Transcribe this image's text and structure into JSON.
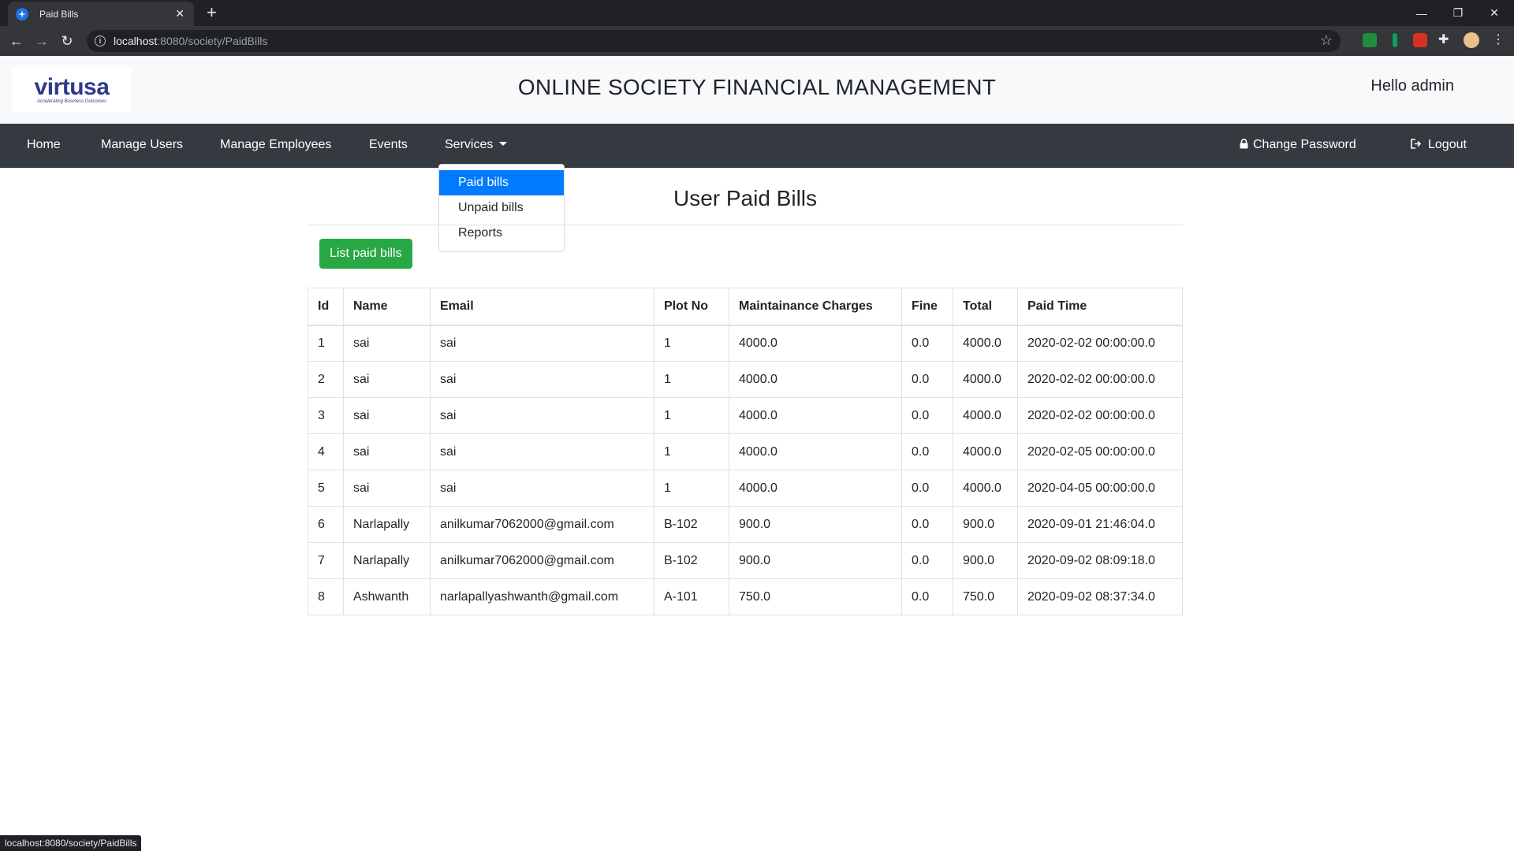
{
  "browser": {
    "tab_title": "Paid Bills",
    "url_host": "localhost",
    "url_rest": ":8080/society/PaidBills",
    "status_url": "localhost:8080/society/PaidBills"
  },
  "header": {
    "logo_text": "virtusa",
    "logo_tagline": "Accelerating Business Outcomes",
    "title": "ONLINE SOCIETY FINANCIAL MANAGEMENT",
    "greeting": "Hello admin"
  },
  "nav": {
    "home": "Home",
    "manage_users": "Manage Users",
    "manage_employees": "Manage Employees",
    "events": "Events",
    "services": "Services",
    "change_password": "Change Password",
    "logout": "Logout"
  },
  "services_menu": {
    "items": [
      "Paid bills",
      "Unpaid bills",
      "Reports"
    ],
    "active": "Paid bills"
  },
  "main": {
    "title": "User Paid Bills",
    "list_button": "List paid bills"
  },
  "table": {
    "headers": [
      "Id",
      "Name",
      "Email",
      "Plot No",
      "Maintainance Charges",
      "Fine",
      "Total",
      "Paid Time"
    ],
    "rows": [
      [
        "1",
        "sai",
        "sai",
        "1",
        "4000.0",
        "0.0",
        "4000.0",
        "2020-02-02 00:00:00.0"
      ],
      [
        "2",
        "sai",
        "sai",
        "1",
        "4000.0",
        "0.0",
        "4000.0",
        "2020-02-02 00:00:00.0"
      ],
      [
        "3",
        "sai",
        "sai",
        "1",
        "4000.0",
        "0.0",
        "4000.0",
        "2020-02-02 00:00:00.0"
      ],
      [
        "4",
        "sai",
        "sai",
        "1",
        "4000.0",
        "0.0",
        "4000.0",
        "2020-02-05 00:00:00.0"
      ],
      [
        "5",
        "sai",
        "sai",
        "1",
        "4000.0",
        "0.0",
        "4000.0",
        "2020-04-05 00:00:00.0"
      ],
      [
        "6",
        "Narlapally",
        "anilkumar7062000@gmail.com",
        "B-102",
        "900.0",
        "0.0",
        "900.0",
        "2020-09-01 21:46:04.0"
      ],
      [
        "7",
        "Narlapally",
        "anilkumar7062000@gmail.com",
        "B-102",
        "900.0",
        "0.0",
        "900.0",
        "2020-09-02 08:09:18.0"
      ],
      [
        "8",
        "Ashwanth",
        "narlapallyashwanth@gmail.com",
        "A-101",
        "750.0",
        "0.0",
        "750.0",
        "2020-09-02 08:37:34.0"
      ]
    ]
  },
  "colors": {
    "navbar": "#343a40",
    "header_bg": "#f8f9fa",
    "button_success": "#28a745",
    "dropdown_active": "#007bff"
  }
}
